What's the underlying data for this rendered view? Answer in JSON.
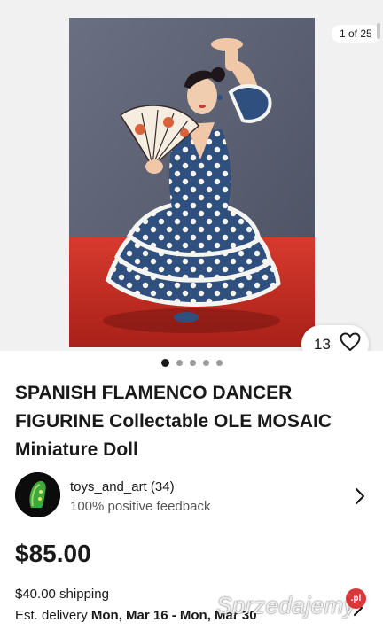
{
  "gallery": {
    "counter": "1 of 25",
    "watch_count": "13",
    "dots": 5,
    "active_dot": 0,
    "icons": {
      "watch": "heart-icon"
    }
  },
  "listing": {
    "title": "SPANISH FLAMENCO DANCER FIGURINE Collectable OLE MOSAIC Miniature Doll",
    "price": "$85.00"
  },
  "seller": {
    "name_rating": "toys_and_art (34)",
    "feedback": "100% positive feedback",
    "icons": {
      "open": "chevron-right-icon"
    }
  },
  "shipping": {
    "cost": "$40.00 shipping",
    "delivery_label": "Est. delivery",
    "delivery_dates": "Mon, Mar 16 - Mon, Mar 30"
  },
  "watermark": {
    "text": "Sprzedajemy",
    "badge": ".pl"
  },
  "colors": {
    "text": "#191919",
    "secondary_text": "#555555",
    "dress_blue": "#2f4f7f",
    "table_red": "#c62a24"
  }
}
